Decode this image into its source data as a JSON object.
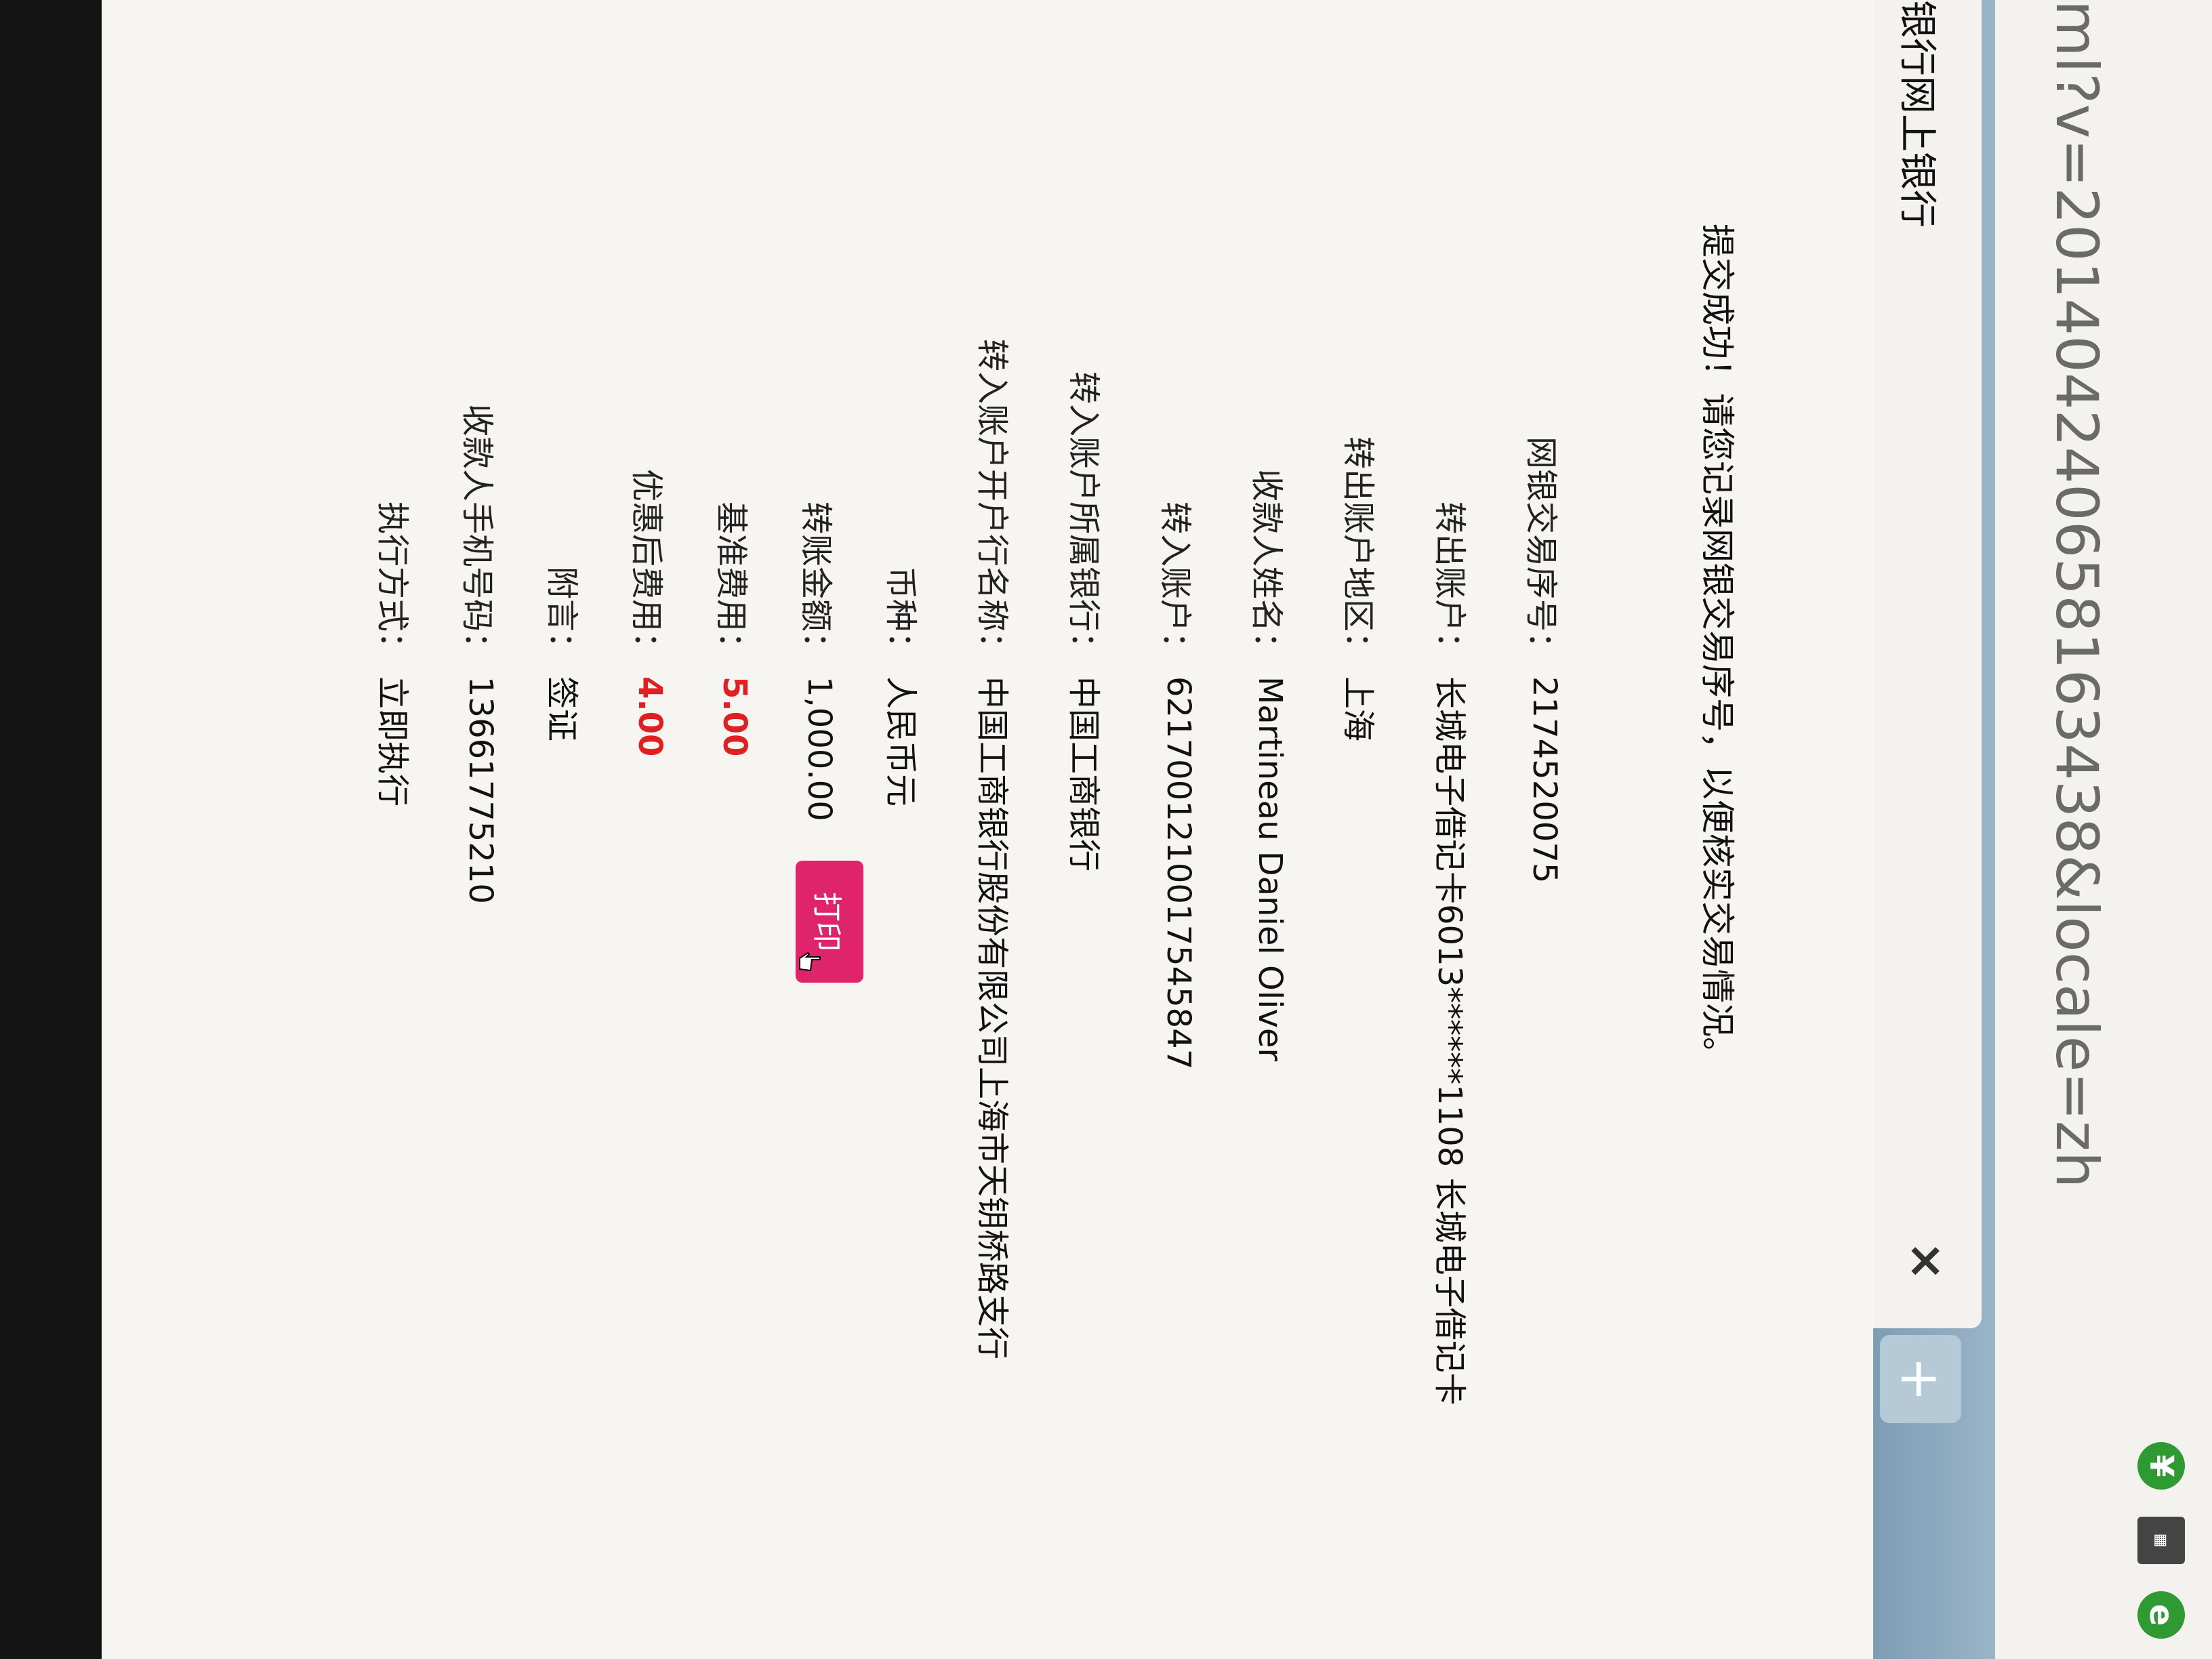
{
  "browser": {
    "url": "ml?v=201404240658163438&locale=zh",
    "tab_title": "银行网上银行",
    "tab_close": "×",
    "new_tab": "+"
  },
  "notice": {
    "text": "提交成功！请您记录网银交易序号，以便核实交易情况。"
  },
  "details": [
    {
      "label": "网银交易序号：",
      "value": "2174520075"
    },
    {
      "label": "转出账户：",
      "value": "长城电子借记卡6013******1108 长城电子借记卡"
    },
    {
      "label": "转出账户地区：",
      "value": "上海"
    },
    {
      "label": "收款人姓名：",
      "value": "Martineau Daniel Oliver"
    },
    {
      "label": "转入账户：",
      "value": "6217001210017545847"
    },
    {
      "label": "转入账户所属银行：",
      "value": "中国工商银行"
    },
    {
      "label": "转入账户开户行名称：",
      "value": "中国工商银行股份有限公司上海市天钥桥路支行"
    },
    {
      "label": "币种：",
      "value": "人民币元"
    },
    {
      "label": "转账金额：",
      "value": "1,000.00"
    },
    {
      "label": "基准费用：",
      "value": "5.00"
    },
    {
      "label": "优惠后费用：",
      "value": "4.00"
    },
    {
      "label": "附言：",
      "value": "签证"
    },
    {
      "label": "收款人手机号码：",
      "value": "13661775210"
    },
    {
      "label": "执行方式：",
      "value": "立即执行"
    }
  ],
  "print_label": "打印",
  "colors": {
    "accent_red": "#e02020",
    "button_pink": "#e0246c"
  }
}
